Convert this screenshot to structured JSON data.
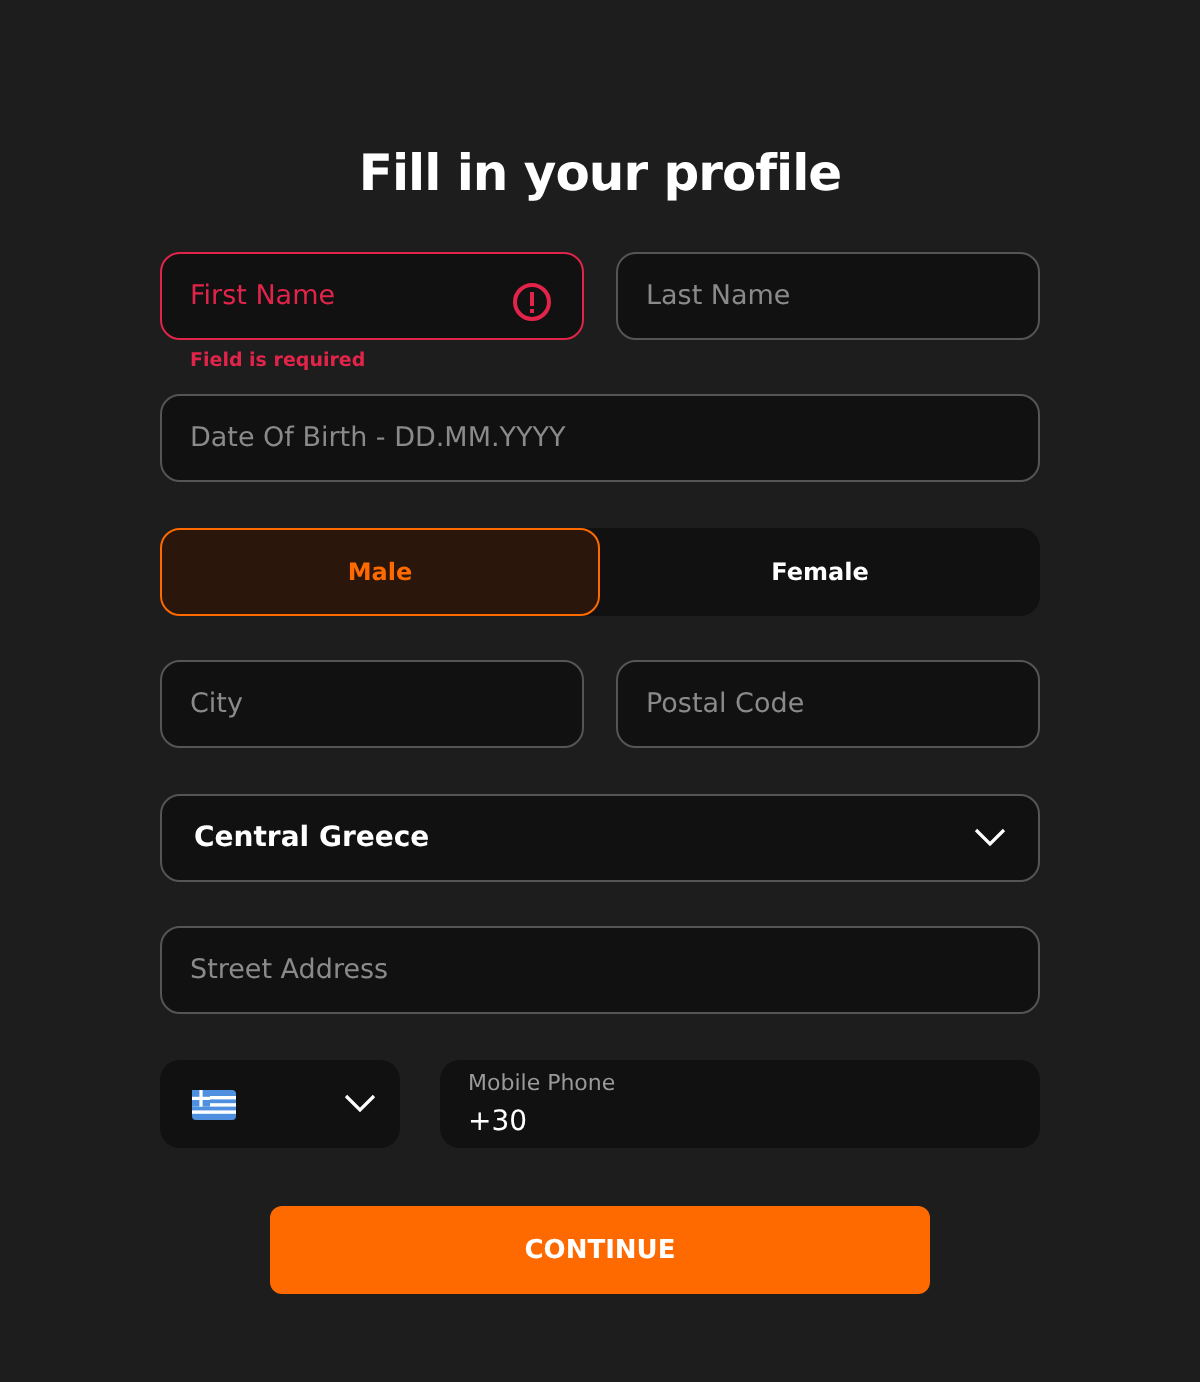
{
  "title": "Fill in your profile",
  "name_fields": [
    {
      "placeholder": "First Name",
      "error": true,
      "error_text": "Field is required"
    },
    {
      "placeholder": "Last Name",
      "error": false
    }
  ],
  "birth_date": {
    "placeholder": "Date Of Birth - DD.MM.YYYY"
  },
  "gender": [
    {
      "label": "Male",
      "selected": true
    },
    {
      "label": "Female",
      "selected": false
    }
  ],
  "location_fields": [
    {
      "placeholder": "City"
    },
    {
      "placeholder": "Postal Code"
    }
  ],
  "region": {
    "value": "Central Greece"
  },
  "street": {
    "placeholder": "Street Address"
  },
  "phone": {
    "label": "Mobile Phone",
    "value": "+30"
  },
  "submit": "CONTINUE"
}
